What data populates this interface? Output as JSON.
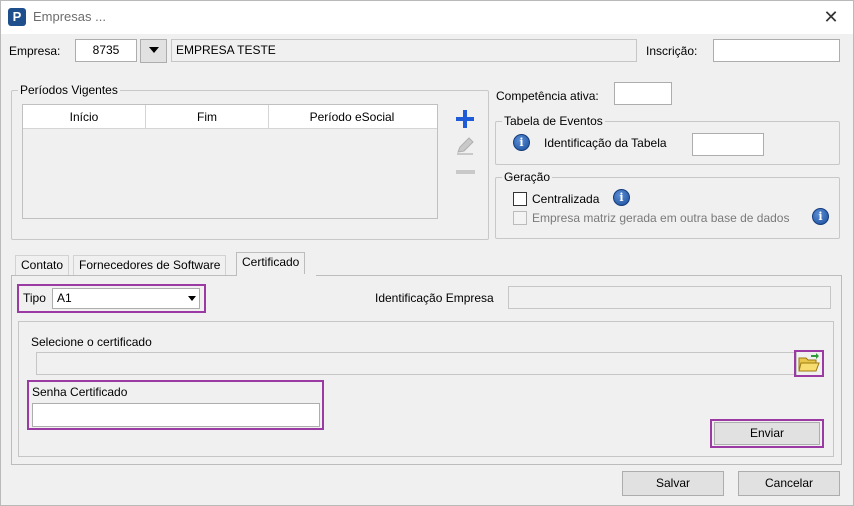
{
  "window": {
    "title": "Empresas ...",
    "app_icon_letter": "P",
    "close_glyph": "✕"
  },
  "header": {
    "empresa_label": "Empresa:",
    "empresa_code": "8735",
    "empresa_name": "EMPRESA TESTE",
    "inscricao_label": "Inscrição:",
    "inscricao_value": ""
  },
  "periodos": {
    "title": "Períodos Vigentes",
    "columns": [
      "Início",
      "Fim",
      "Período eSocial"
    ],
    "add_glyph": "+",
    "remove_glyph": "—"
  },
  "competencia": {
    "label": "Competência ativa:",
    "value": ""
  },
  "tabela_eventos": {
    "title": "Tabela de Eventos",
    "identificacao_label": "Identificação da Tabela",
    "identificacao_value": ""
  },
  "geracao": {
    "title": "Geração",
    "centralizada_label": "Centralizada",
    "matriz_label": "Empresa matriz gerada em outra base de dados"
  },
  "tabs": [
    {
      "label": "Contato"
    },
    {
      "label": "Fornecedores de Software"
    },
    {
      "label": "Certificado"
    }
  ],
  "certificado": {
    "tipo_label": "Tipo",
    "tipo_value": "A1",
    "identificacao_label": "Identificação Empresa",
    "identificacao_value": "",
    "selecione_label": "Selecione o certificado",
    "selecione_value": "",
    "senha_label": "Senha Certificado",
    "senha_value": "",
    "enviar_label": "Enviar"
  },
  "footer": {
    "salvar_label": "Salvar",
    "cancelar_label": "Cancelar"
  },
  "colors": {
    "highlight": "#9b3aa3",
    "add_icon": "#1e5bd6",
    "info_icon": "#1a4c9a"
  }
}
